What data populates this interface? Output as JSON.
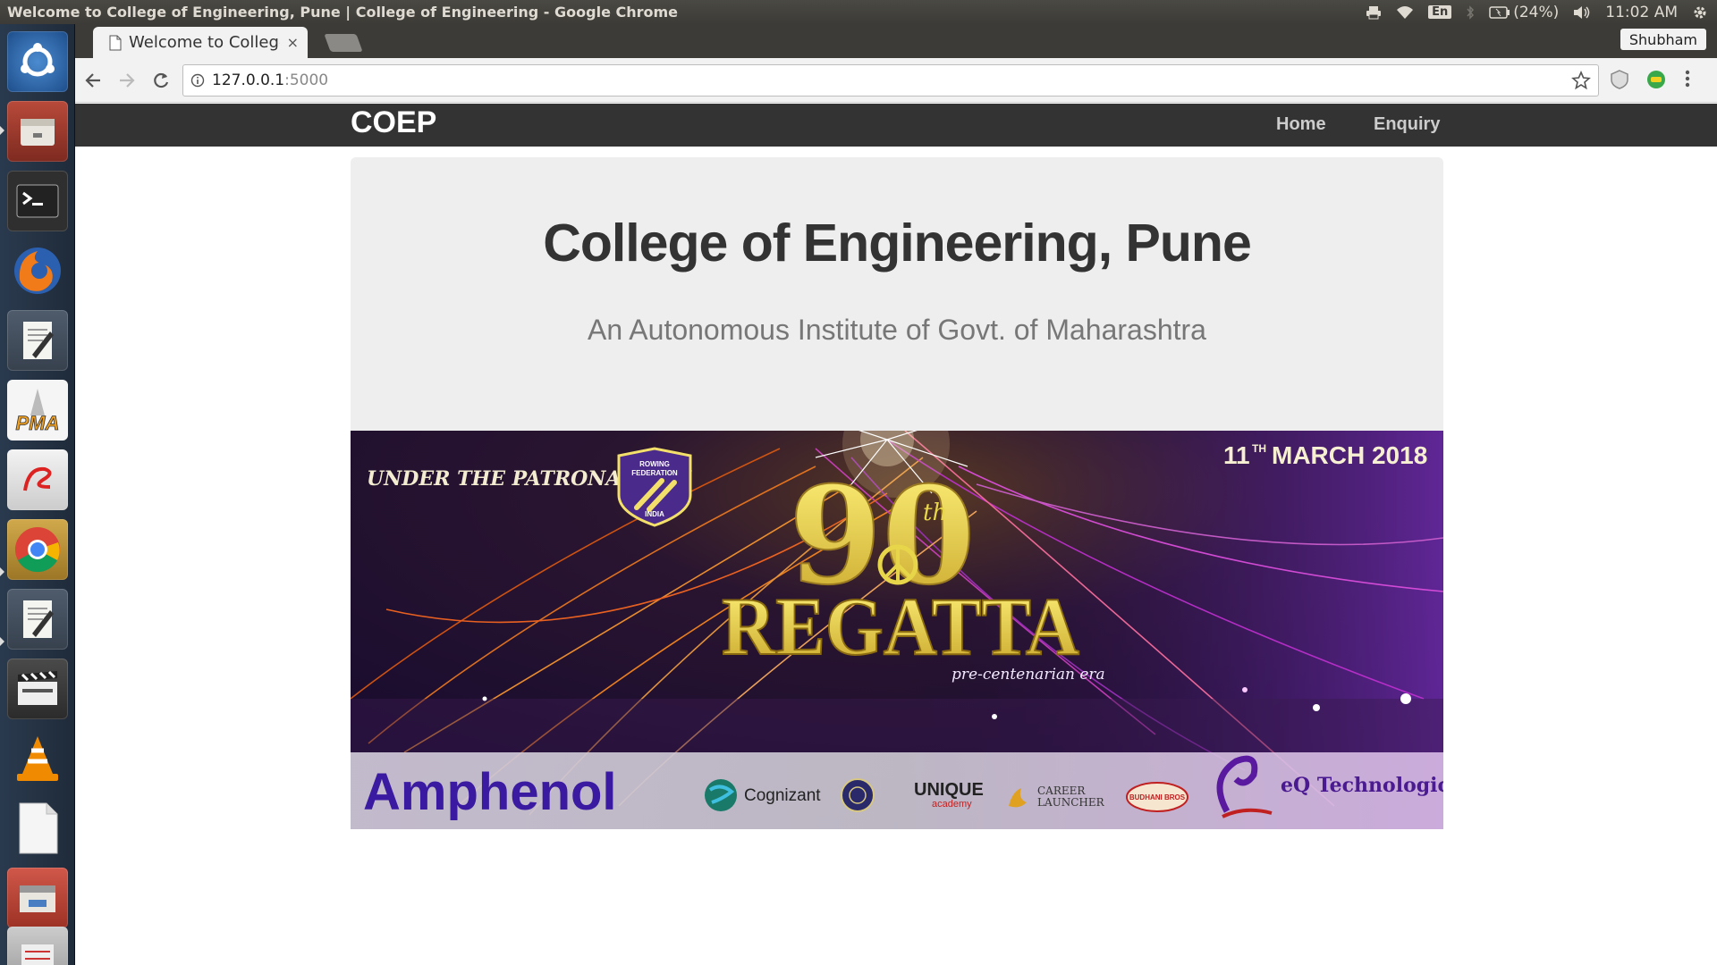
{
  "os": {
    "window_title": "Welcome to College of Engineering, Pune | College of Engineering - Google Chrome",
    "keyboard_layout": "En",
    "battery": "(24%)",
    "clock": "11:02 AM"
  },
  "launcher": {
    "items": [
      "ubuntu-dash",
      "files",
      "terminal",
      "firefox",
      "text-editor",
      "phpmyadmin",
      "evince",
      "chrome",
      "gedit",
      "video-editor",
      "vlc",
      "libreoffice",
      "file-manager",
      "archive"
    ]
  },
  "browser": {
    "tab_title": "Welcome to College of Engineering, Pune | College of Engineering",
    "tab_close": "×",
    "profile": "Shubham",
    "url_host": "127.0.0.1",
    "url_port": ":5000"
  },
  "site": {
    "brand": "COEP",
    "nav": {
      "home": "Home",
      "enquiry": "Enquiry"
    },
    "heading": "College of Engineering, Pune",
    "subheading": "An Autonomous Institute of Govt. of Maharashtra"
  },
  "banner": {
    "patronage": "UNDER THE PATRONAGE OF",
    "badge_line1": "ROWING",
    "badge_line2": "FEDERATION",
    "badge_line3": "INDIA",
    "date_day": "11",
    "date_suffix": "TH",
    "date_rest": "MARCH 2018",
    "edition": "90",
    "edition_suffix": "th",
    "event": "REGATTA",
    "tagline": "pre-centenarian era",
    "sponsors": {
      "amphenol": "Amphenol",
      "cognizant": "Cognizant",
      "unique": "UNIQUE",
      "unique_sub": "academy",
      "career1": "CAREER",
      "career2": "LAUNCHER",
      "budhani": "BUDHANI BROS",
      "eq": "eQ Technologic"
    }
  },
  "colors": {
    "nav_bg": "#333333",
    "jumbotron_bg": "#eeeeee",
    "heading": "#333333",
    "subheading": "#777777",
    "banner_gold": "#e8d64a"
  }
}
